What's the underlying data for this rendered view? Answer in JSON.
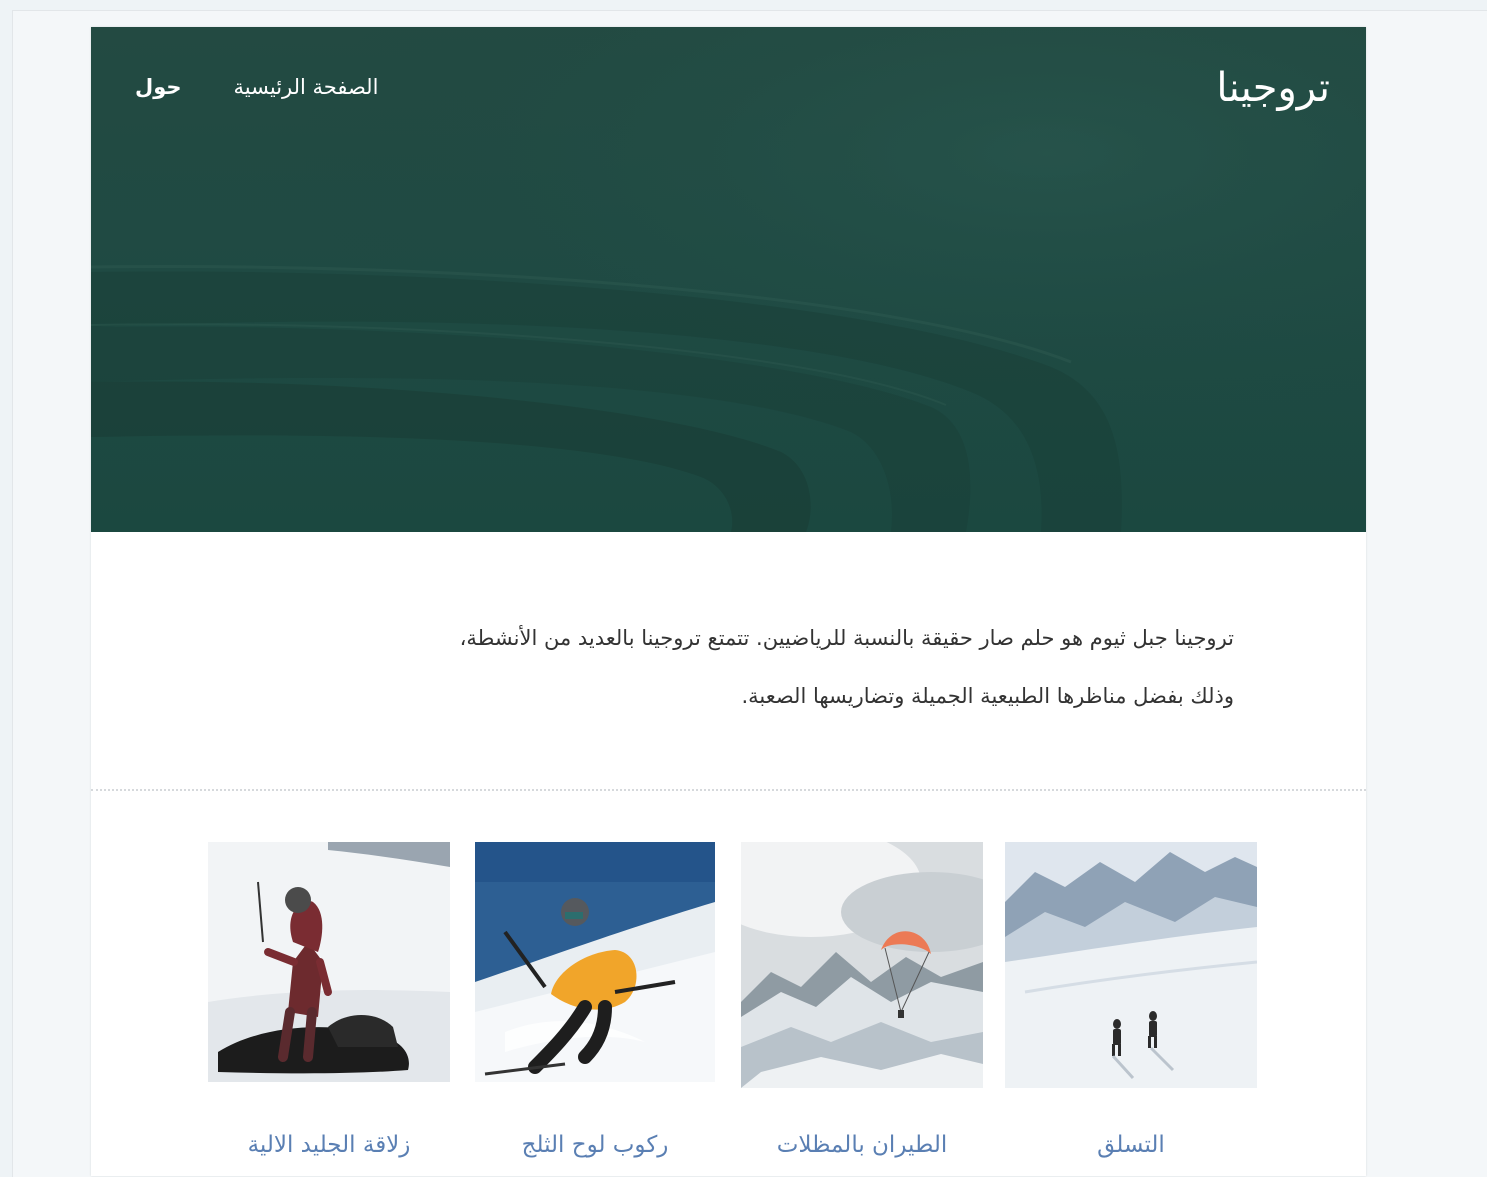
{
  "site": {
    "title": "تروجينا",
    "nav": [
      {
        "label": "الصفحة الرئيسية"
      },
      {
        "label": "حول"
      }
    ]
  },
  "intro": {
    "line1": "تروجينا جبل ثيوم هو حلم صار حقيقة بالنسبة للرياضيين. تتمتع تروجينا بالعديد من الأنشطة،",
    "line2": "وذلك بفضل مناظرها الطبيعية الجميلة وتضاريسها الصعبة."
  },
  "activities": [
    {
      "label": "التسلق",
      "icon": "mountain-climbers-photo"
    },
    {
      "label": "الطيران بالمظلات",
      "icon": "paraglider-photo"
    },
    {
      "label": "ركوب لوح الثلج",
      "icon": "skier-photo"
    },
    {
      "label": "زلاقة الجليد الالية",
      "icon": "snowmobile-photo"
    }
  ],
  "colors": {
    "hero": "#1f4a43",
    "link": "#5a7fb3",
    "text": "#333333"
  }
}
